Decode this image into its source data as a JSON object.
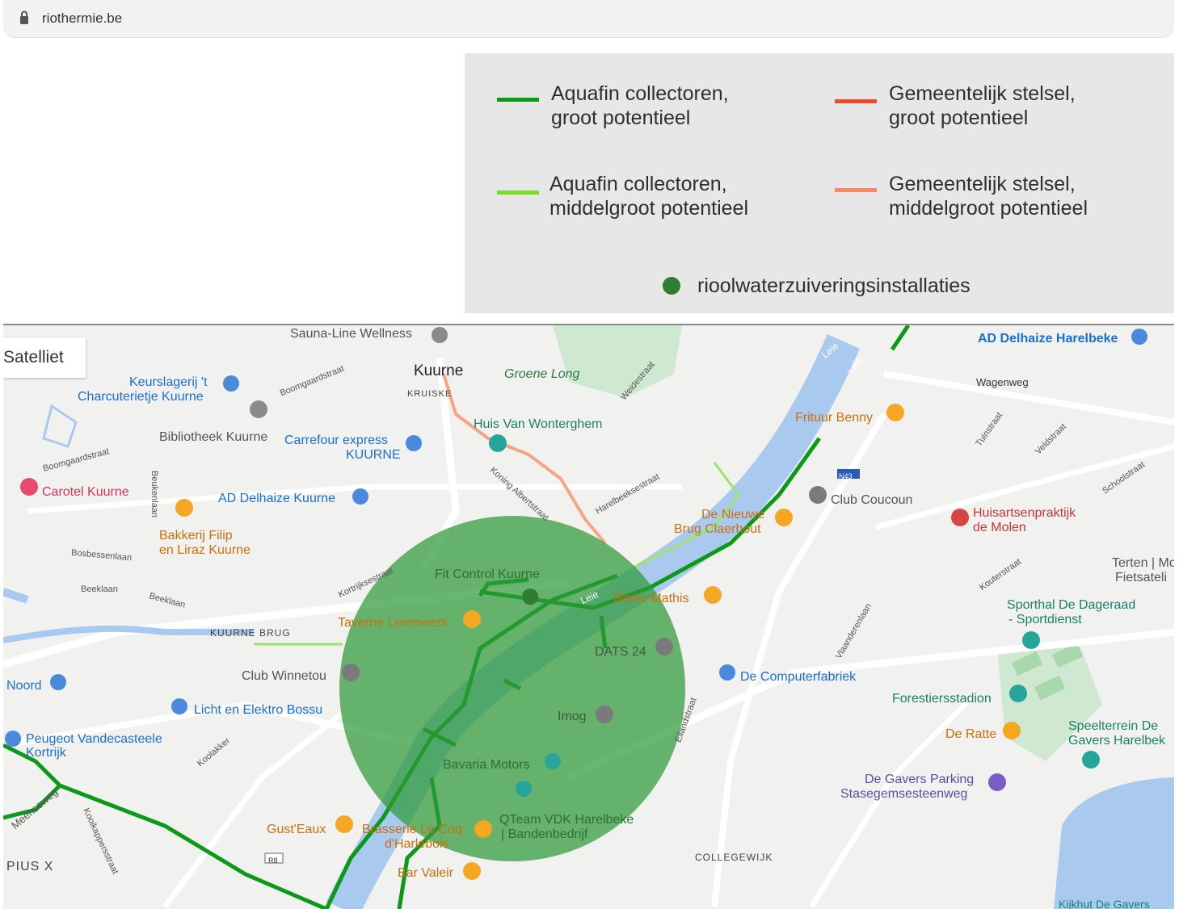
{
  "browser": {
    "url": "riothermie.be"
  },
  "legend": {
    "items": [
      {
        "line1": "Aquafin collectoren,",
        "line2": "groot potentieel",
        "color": "#0a9a18"
      },
      {
        "line1": "Gemeentelijk stelsel,",
        "line2": "groot potentieel",
        "color": "#ef4a28"
      },
      {
        "line1": "Aquafin collectoren,",
        "line2": "middelgroot potentieel",
        "color": "#7bdc2a"
      },
      {
        "line1": "Gemeentelijk stelsel,",
        "line2": "middelgroot potentieel",
        "color": "#f58a63"
      }
    ],
    "plant": {
      "label": "rioolwaterzuiveringsinstallaties",
      "color": "#2e7d32"
    }
  },
  "map": {
    "satellite_label": "Satelliet",
    "places": {
      "sauna": "Sauna-Line Wellness",
      "kuurne": "Kuurne",
      "kruiske": "KRUISKE",
      "groene_long": "Groene Long",
      "keurslagerij_1": "Keurslagerij 't",
      "keurslagerij_2": "Charcuterietje Kuurne",
      "bibliotheek": "Bibliotheek Kuurne",
      "carrefour_1": "Carrefour express",
      "carrefour_2": "KUURNE",
      "huis_van": "Huis Van Wonterghem",
      "carotel": "Carotel Kuurne",
      "ad_delhaize_kuurne": "AD Delhaize Kuurne",
      "bakkerij_1": "Bakkerij Filip",
      "bakkerij_2": "en Liraz Kuurne",
      "ad_delhaize_harelbeke": "AD Delhaize Harelbeke",
      "wagenweg": "Wagenweg",
      "frituur": "Frituur Benny",
      "n43": "N43",
      "club_coucoun": "Club Coucoun",
      "de_nieuwe_1": "De Nieuwe",
      "de_nieuwe_2": "Brug Claerhout",
      "huisarts_1": "Huisartsenpraktijk",
      "huisarts_2": "de Molen",
      "terten_1": "Terten | Mobi",
      "terten_2": "Fietsateli",
      "fit_control": "Fit Control Kuurne",
      "bistro": "Bistro Mathis",
      "taverne": "Taverne Leiemeers",
      "kuurne_brug": "KUURNE BRUG",
      "dats": "DATS 24",
      "sporthal_1": "Sporthal De Dageraad",
      "sporthal_2": "- Sportdienst",
      "noord": "Noord",
      "club_winnetou": "Club Winnetou",
      "computerfabriek": "De Computerfabriek",
      "licht": "Licht en Elektro Bossu",
      "imog": "Imog",
      "forestiers": "Forestiersstadion",
      "peugeot_1": "Peugeot Vandecasteele",
      "peugeot_2": "Kortrijk",
      "de_ratte": "De Ratte",
      "speelterrein_1": "Speelterrein De",
      "speelterrein_2": "Gavers Harelbek",
      "bavaria": "Bavaria Motors",
      "gavers_parking_1": "De Gavers Parking",
      "gavers_parking_2": "Stasegemsesteenweg",
      "qteam_1": "QTeam VDK Harelbeke",
      "qteam_2": "| Bandenbedrijf",
      "gust_eaux": "Gust'Eaux",
      "brasserie_1": "Brasserie Le Coq",
      "brasserie_2": "d'Harlebois",
      "r8": "R8",
      "pius": "PIUS X",
      "bar_valeir": "Bar Valeir",
      "collegewijk": "COLLEGEWIJK",
      "kijkhut": "Kijkhut De Gavers"
    },
    "streets": {
      "boomgaardstraat_1": "Boomgaardstraat",
      "boomgaardstraat_2": "Boomgaardstraat",
      "beukenlaan": "Beukenlaan",
      "bosbessenlaan": "Bosbessenlaan",
      "beeklaan_1": "Beeklaan",
      "beeklaan_2": "Beeklaan",
      "kortrijksestraat": "Kortrijksestraat",
      "koning_albertstraat": "Koning Albertstraat",
      "harelbeeksestraat": "Harelbeeksestraat",
      "weidestraat": "Weidestraat",
      "tuinstraat": "Tuinstraat",
      "veldstraat": "Veldstraat",
      "schoolstraat": "Schoolstraat",
      "kouterstraat": "Kouterstraat",
      "vlasvelastraat": "Vlaanderenlaan",
      "eilandstraat": "Eilandstraat",
      "koolakker": "Koolakker",
      "steenweg": "Meenseweg",
      "kooikappersstraat": "Kooikappersstraat",
      "leie_1": "Leie",
      "leie_2": "Leie",
      "leie_3": "Leie"
    }
  }
}
